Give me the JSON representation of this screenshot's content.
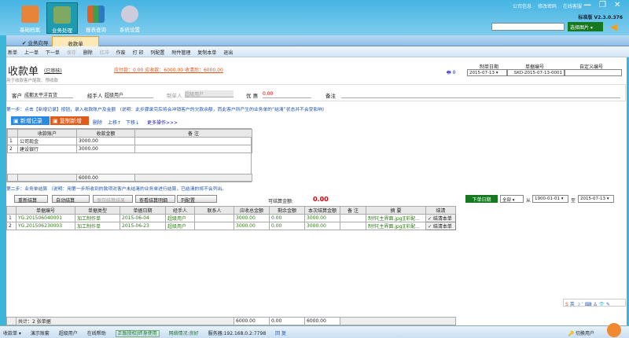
{
  "nav": [
    {
      "label": "基础档案"
    },
    {
      "label": "业务处理"
    },
    {
      "label": "报表查询"
    },
    {
      "label": "系统设置"
    }
  ],
  "top_links": [
    "公司信息",
    "修改密码",
    "在线客服"
  ],
  "version": "标准版 V2.3.0.376",
  "select_image": "选择图片",
  "tabs": [
    "业务向导",
    "收款单"
  ],
  "toolbar": [
    "新单",
    "上一单",
    "下一单",
    "保存",
    "删除",
    "红冲",
    "作废",
    "打 印",
    "列配置",
    "附件管理",
    "复制本单",
    "退出"
  ],
  "doc": {
    "title": "收款单",
    "status": "(已审核)",
    "subtitle": "用于收款客户尾款、预收款",
    "summary": "应付款：0.00  应收款：6000.00  收清后：6000.00",
    "print_count": "0",
    "date_label": "制单日期",
    "date": "2015-07-13",
    "no_label": "单据编号",
    "no": "SKD-2015-07-13-0001",
    "custom_label": "自定义编号",
    "custom": ""
  },
  "fields": {
    "customer_label": "客户",
    "customer": "成都太平洋百货",
    "handler_label": "经手人",
    "handler": "超级用户",
    "maker_label": "制单人",
    "maker": "超级用户",
    "discount_label": "优 惠",
    "discount": "0.00",
    "remark_label": "备注"
  },
  "step1": "第一步：点击【新增记录】按钮，录入收款账户及金额 （说明：此步骤录完后将会冲销客户的欠款余额，而此客户所产生的业务单的“结清”状态并不会受影响）",
  "step1_actions": {
    "add": "新增记录",
    "copy": "复制新增",
    "delete": "删除",
    "up": "上移↑",
    "down": "下移↓",
    "more": "更多操作>>>"
  },
  "acct_table": {
    "headers": [
      "收款账户",
      "收款金额",
      "备 注"
    ],
    "rows": [
      [
        "1",
        "公司现金",
        "3000.00",
        ""
      ],
      [
        "2",
        "建设银行",
        "3000.00",
        ""
      ]
    ],
    "total": "6000.00"
  },
  "step2": "第二步：业务单结算 （说明：用第一步所收到的款项对客户未结清的业务单进行结算，已结清的将不会列出。",
  "step2_actions": [
    "重新结算",
    "自动结算",
    "保存结算结果",
    "查看结算明细",
    "列配置"
  ],
  "settle_label": "可结算金额:",
  "settle_amount": "0.00",
  "filter": {
    "button": "下单日期",
    "scope": "全部",
    "from_label": "从",
    "from": "1900-01-01",
    "to_label": "至",
    "to": "2015-07-13"
  },
  "bill_table": {
    "headers": [
      "单据编号",
      "单据类型",
      "单据日期",
      "经手人",
      "联系人",
      "应收总金额",
      "剩余金额",
      "本次结算金额",
      "备 注",
      "摘 要",
      "结清"
    ],
    "rows": [
      [
        "1",
        "YG.201506040001",
        "加工制作单",
        "2015-06-04",
        "超级用户",
        "",
        "3000.00",
        "0.00",
        "3000.00",
        "",
        "制作[主界面.jpg][彩配...",
        "✓ 结清本单"
      ],
      [
        "2",
        "YG.201506230003",
        "加工制作单",
        "2015-06-23",
        "超级用户",
        "",
        "3000.00",
        "0.00",
        "3000.00",
        "",
        "制作[主界面.jpg][彩配...",
        "✓ 结清本单"
      ]
    ],
    "footer": {
      "count": "共计：2 张单据",
      "total": "6000.00",
      "remain": "0.00",
      "settle": "6000.00"
    }
  },
  "status": [
    "收款单 ▾",
    "演示账套",
    "超级用户",
    "在线帮助",
    "正版授权|终身使用",
    "网络情况:良好",
    "服务器:192.168.0.2:7798",
    "回 复"
  ],
  "switch_user": "切换用户"
}
